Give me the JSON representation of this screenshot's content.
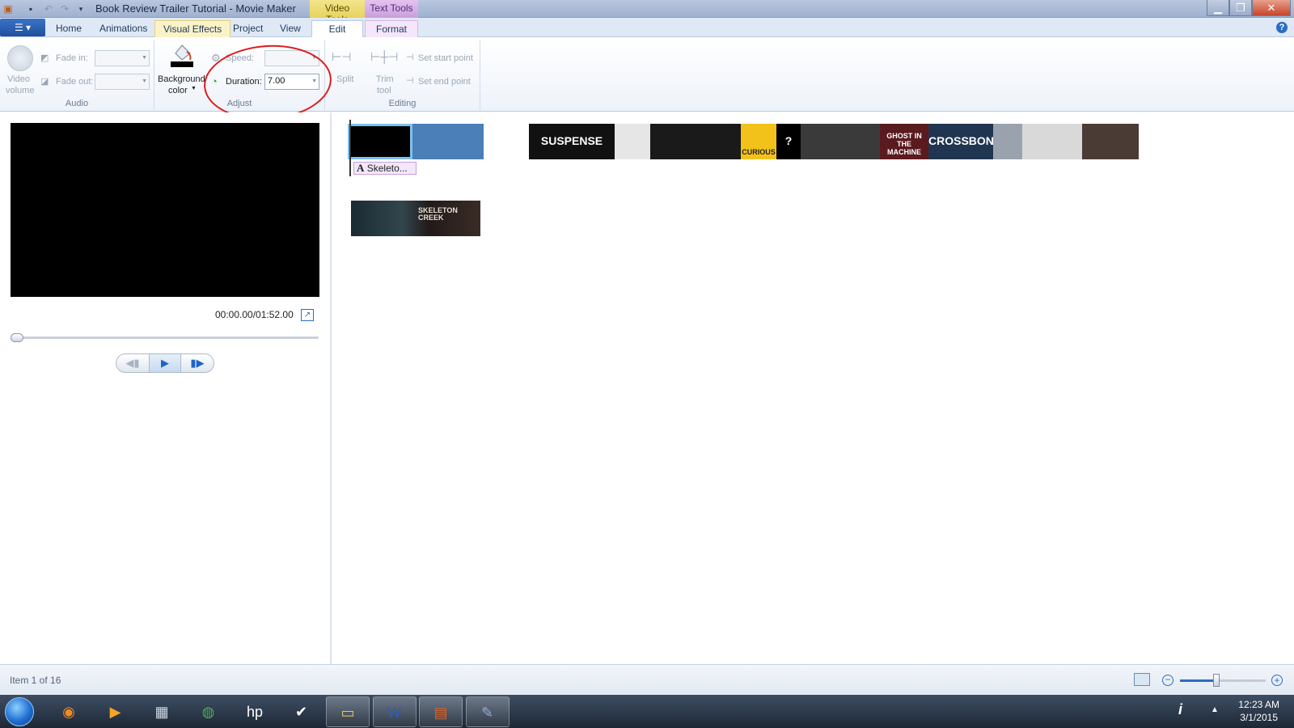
{
  "window": {
    "title": "Book Review Trailer Tutorial - Movie Maker",
    "context_tabs": {
      "video_tools": "Video Tools",
      "text_tools": "Text Tools"
    },
    "controls": {
      "minimize": "▁",
      "maximize": "❐",
      "close": "✕"
    }
  },
  "ribbon": {
    "tabs": [
      {
        "label": "Home"
      },
      {
        "label": "Animations"
      },
      {
        "label": "Visual Effects"
      },
      {
        "label": "Project"
      },
      {
        "label": "View"
      },
      {
        "label": "Edit"
      },
      {
        "label": "Format"
      }
    ],
    "active_tab": "Edit",
    "groups": {
      "audio": {
        "label": "Audio",
        "video_volume_line1": "Video",
        "video_volume_line2": "volume",
        "fade_in_label": "Fade in:",
        "fade_out_label": "Fade out:"
      },
      "adjust": {
        "label": "Adjust",
        "background_color_line1": "Background",
        "background_color_line2": "color",
        "speed_label": "Speed:",
        "duration_label": "Duration:",
        "duration_value": "7.00"
      },
      "editing": {
        "label": "Editing",
        "split": "Split",
        "trim_line1": "Trim",
        "trim_line2": "tool",
        "set_start": "Set start point",
        "set_end": "Set end point"
      }
    }
  },
  "preview": {
    "time": "00:00.00/01:52.00",
    "playback_position": 0.0
  },
  "storyboard": {
    "clips": [
      {
        "text": "",
        "color": "#000000",
        "selected": true
      },
      {
        "text": "",
        "color": "#4a7fb8"
      },
      {
        "text": "",
        "color": "#ffffff"
      },
      {
        "text": "SUSPENSE",
        "color": "#111111"
      },
      {
        "text": "",
        "color": "#e6e6e6"
      },
      {
        "text": "",
        "color": "#1a1a1a"
      },
      {
        "text": "CURIOUS",
        "color": "#f2c21a"
      },
      {
        "text": "?",
        "color": "#000000"
      },
      {
        "text": "",
        "color": "#3a3a3a"
      },
      {
        "text": "GHOST IN THE MACHINE",
        "color": "#5a1a1e"
      },
      {
        "text": "CROSSBONES",
        "color": "#1f3550"
      },
      {
        "text": "",
        "color": "#9aa3ad"
      },
      {
        "text": "",
        "color": "#d9d9d9"
      },
      {
        "text": "",
        "color": "#4a3c35"
      }
    ],
    "caption": "Skeleto...",
    "music_clip_text": "SKELETON CREEK"
  },
  "status": {
    "item_text": "Item 1 of 16",
    "zoom_level": 0.42
  },
  "taskbar": {
    "apps": [
      "firefox-icon",
      "media-player-icon",
      "calculator-icon",
      "chrome-icon",
      "hp-icon",
      "check-icon",
      "explorer-icon",
      "word-icon",
      "movie-maker-icon",
      "paint-icon"
    ],
    "time": "12:23 AM",
    "date": "3/1/2015"
  }
}
